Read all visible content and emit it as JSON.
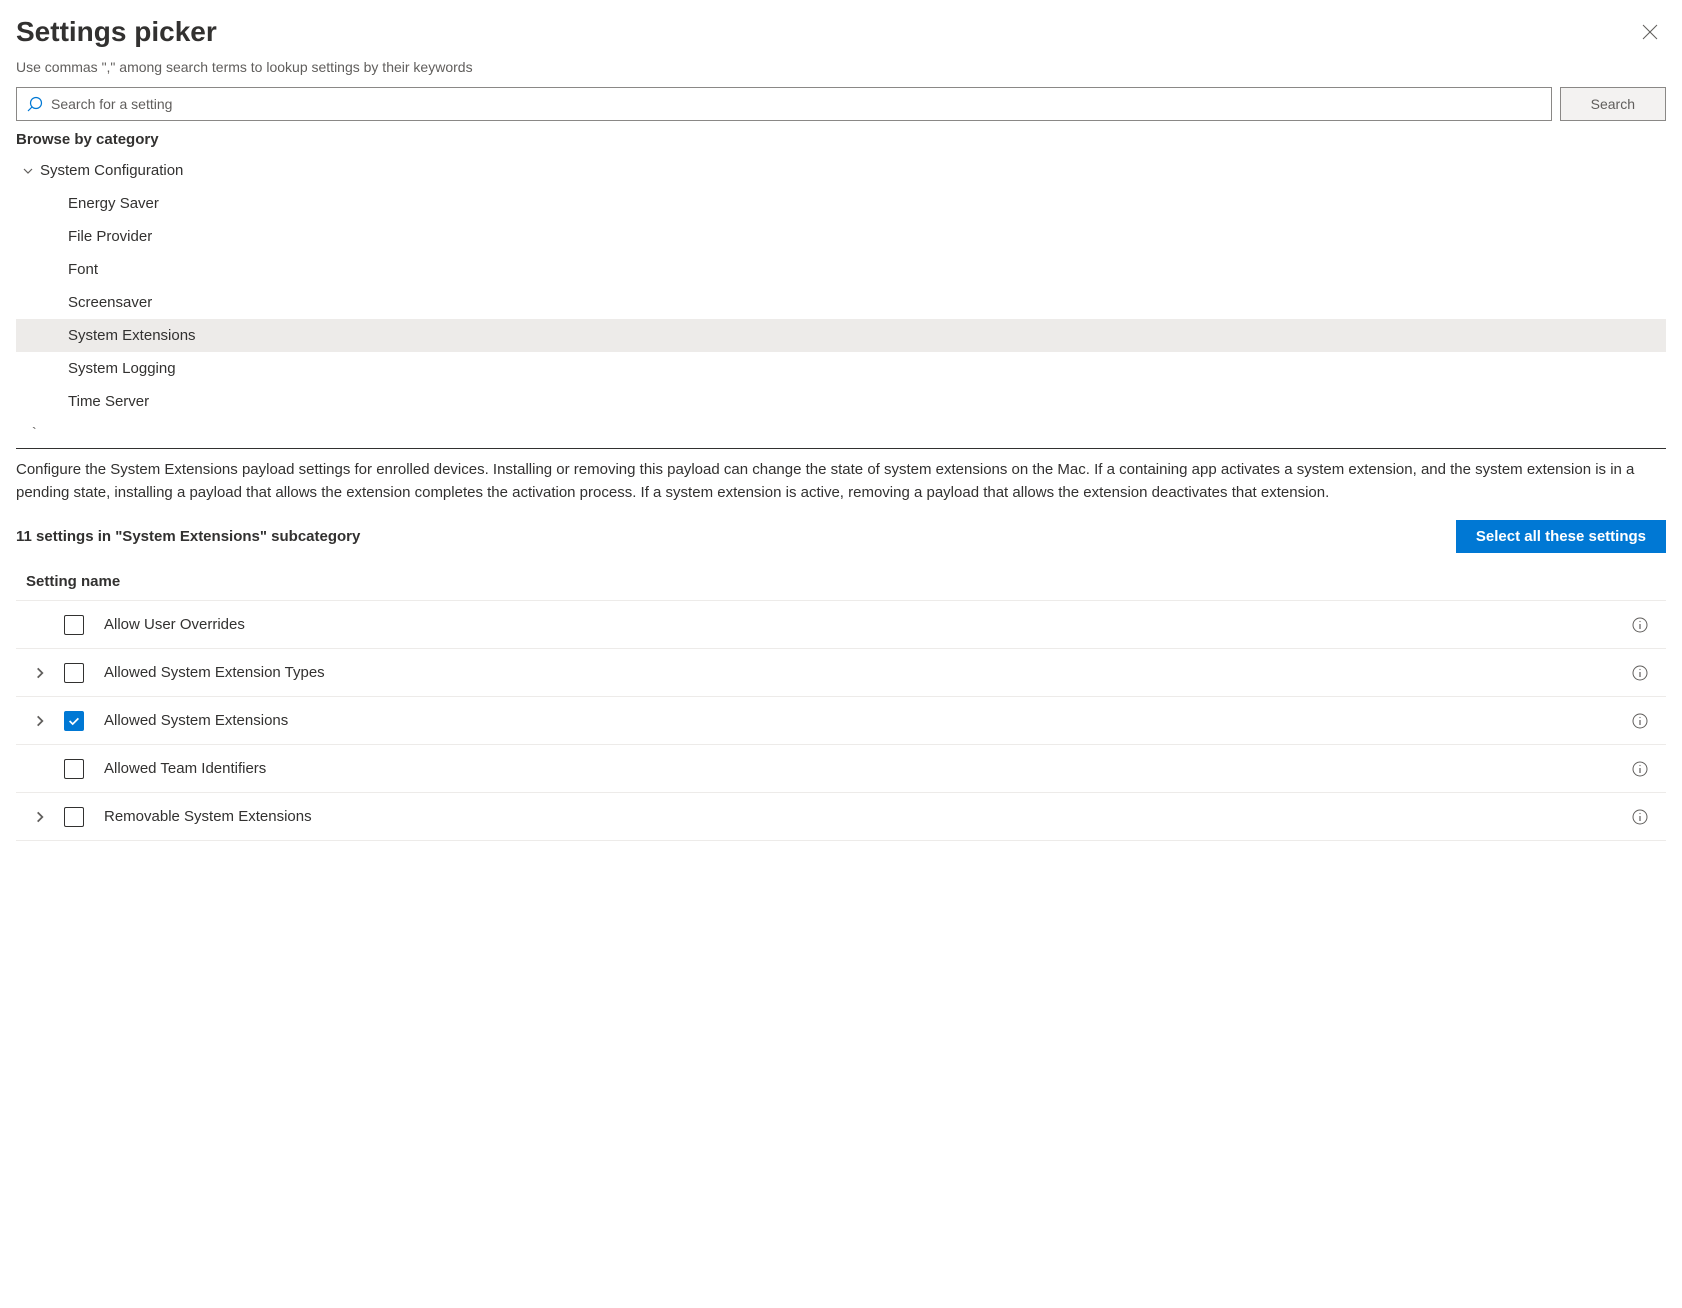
{
  "header": {
    "title": "Settings picker",
    "subtitle": "Use commas \",\" among search terms to lookup settings by their keywords"
  },
  "search": {
    "placeholder": "Search for a setting",
    "button_label": "Search"
  },
  "browse": {
    "label": "Browse by category",
    "parent_label": "System Configuration",
    "items": [
      {
        "label": "Energy Saver",
        "selected": false
      },
      {
        "label": "File Provider",
        "selected": false
      },
      {
        "label": "Font",
        "selected": false
      },
      {
        "label": "Screensaver",
        "selected": false
      },
      {
        "label": "System Extensions",
        "selected": true
      },
      {
        "label": "System Logging",
        "selected": false
      },
      {
        "label": "Time Server",
        "selected": false
      }
    ]
  },
  "description": "Configure the System Extensions payload settings for enrolled devices. Installing or removing this payload can change the state of system extensions on the Mac. If a containing app activates a system extension, and the system extension is in a pending state, installing a payload that allows the extension completes the activation process. If a system extension is active, removing a payload that allows the extension deactivates that extension.",
  "subcategory": {
    "count_label": "11 settings in \"System Extensions\" subcategory",
    "select_all_label": "Select all these settings"
  },
  "table": {
    "header": "Setting name",
    "rows": [
      {
        "name": "Allow User Overrides",
        "expandable": false,
        "checked": false
      },
      {
        "name": "Allowed System Extension Types",
        "expandable": true,
        "checked": false
      },
      {
        "name": "Allowed System Extensions",
        "expandable": true,
        "checked": true
      },
      {
        "name": "Allowed Team Identifiers",
        "expandable": false,
        "checked": false
      },
      {
        "name": "Removable System Extensions",
        "expandable": true,
        "checked": false
      }
    ]
  }
}
